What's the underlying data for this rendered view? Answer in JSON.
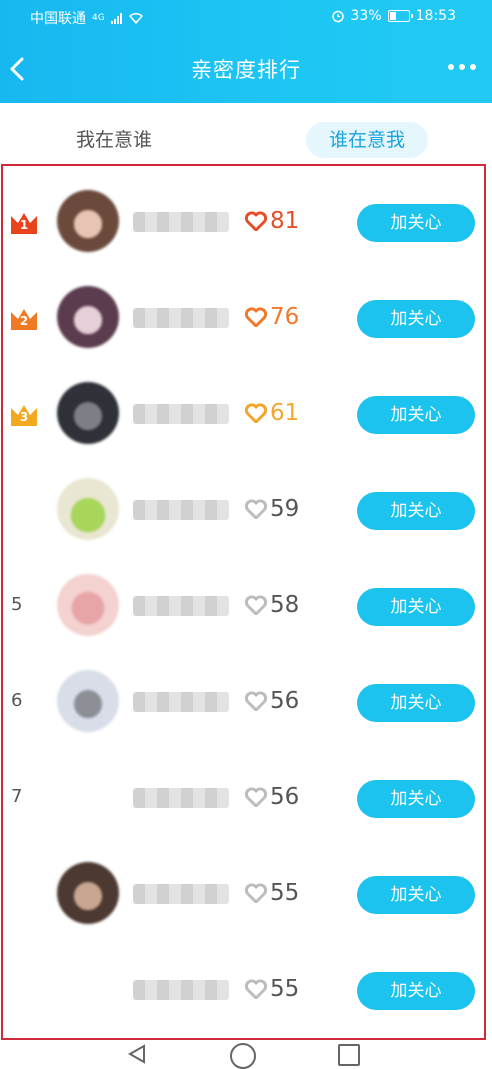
{
  "status_bar": {
    "carrier": "中国联通",
    "network": "4G",
    "battery": "33%",
    "time": "18:53"
  },
  "header": {
    "title": "亲密度排行",
    "back_icon": "chevron-left-icon",
    "more_icon": "more-dots-icon"
  },
  "tabs": [
    {
      "label": "我在意谁",
      "active": false
    },
    {
      "label": "谁在意我",
      "active": true
    }
  ],
  "rows": [
    {
      "rank": "1",
      "rank_style": "crown",
      "crown_color": "#e8431c",
      "score": "81",
      "heart_color": "#e2502a",
      "follow_label": "加关心"
    },
    {
      "rank": "2",
      "rank_style": "crown",
      "crown_color": "#f07a23",
      "score": "76",
      "heart_color": "#ef7a2b",
      "follow_label": "加关心"
    },
    {
      "rank": "3",
      "rank_style": "crown",
      "crown_color": "#f3a91f",
      "score": "61",
      "heart_color": "#f3a62b",
      "follow_label": "加关心"
    },
    {
      "rank": "",
      "rank_style": "text",
      "score": "59",
      "heart_color": "#bdbdbd",
      "follow_label": "加关心"
    },
    {
      "rank": "5",
      "rank_style": "text",
      "score": "58",
      "heart_color": "#bdbdbd",
      "follow_label": "加关心"
    },
    {
      "rank": "6",
      "rank_style": "text",
      "score": "56",
      "heart_color": "#bdbdbd",
      "follow_label": "加关心"
    },
    {
      "rank": "7",
      "rank_style": "text",
      "score": "56",
      "heart_color": "#bdbdbd",
      "follow_label": "加关心"
    },
    {
      "rank": "",
      "rank_style": "text",
      "score": "55",
      "heart_color": "#bdbdbd",
      "follow_label": "加关心"
    },
    {
      "rank": "",
      "rank_style": "text",
      "score": "55",
      "heart_color": "#bdbdbd",
      "follow_label": "加关心"
    }
  ],
  "colors": {
    "header_start": "#17b8f0",
    "header_end": "#21c9f2",
    "follow_button": "#1cc3ef",
    "active_tab_text": "#1aa5e0",
    "active_tab_bg": "#e6f6fd",
    "frame_border": "#cf2a3a"
  }
}
